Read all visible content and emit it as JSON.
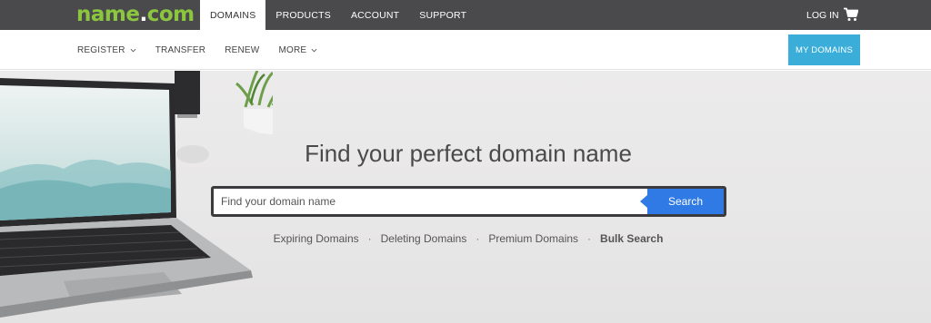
{
  "brand": {
    "logo_main": "name",
    "logo_dot": ".",
    "logo_tld": "com"
  },
  "topnav": {
    "tabs": [
      {
        "label": "DOMAINS",
        "active": true
      },
      {
        "label": "PRODUCTS"
      },
      {
        "label": "ACCOUNT"
      },
      {
        "label": "SUPPORT"
      }
    ],
    "login_label": "LOG IN",
    "cart_icon": "cart-icon"
  },
  "subnav": {
    "items": [
      {
        "label": "REGISTER",
        "has_dropdown": true
      },
      {
        "label": "TRANSFER"
      },
      {
        "label": "RENEW"
      },
      {
        "label": "MORE",
        "has_dropdown": true
      }
    ],
    "my_domains_label": "MY DOMAINS"
  },
  "hero": {
    "title": "Find your perfect domain name",
    "search_placeholder": "Find your domain name",
    "search_button": "Search",
    "links": [
      {
        "label": "Expiring Domains"
      },
      {
        "label": "Deleting Domains"
      },
      {
        "label": "Premium Domains"
      },
      {
        "label": "Bulk Search",
        "bold": true
      }
    ],
    "separator": "·"
  },
  "colors": {
    "topbar": "#4a4a4d",
    "logo_green": "#8cc63f",
    "my_domains_bg": "#3aaed8",
    "search_button_bg": "#2f7ae5"
  }
}
